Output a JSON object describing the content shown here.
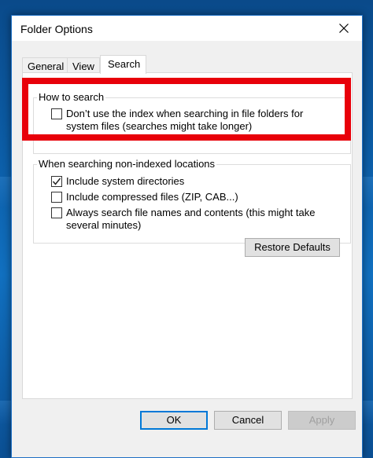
{
  "dialog": {
    "title": "Folder Options"
  },
  "tabs": [
    {
      "label": "General",
      "active": false
    },
    {
      "label": "View",
      "active": false
    },
    {
      "label": "Search",
      "active": true
    }
  ],
  "how_to_search": {
    "label": "How to search",
    "options": [
      {
        "line1": "Don’t use the index when searching in file folders for",
        "line2": "system files (searches might take longer)",
        "checked": false
      }
    ]
  },
  "non_indexed": {
    "label": "When searching non-indexed locations",
    "options": [
      {
        "line1": "Include system directories",
        "line2": "",
        "checked": true
      },
      {
        "line1": "Include compressed files (ZIP, CAB...)",
        "line2": "",
        "checked": false
      },
      {
        "line1": "Always search file names and contents (this might take",
        "line2": "several minutes)",
        "checked": false
      }
    ]
  },
  "buttons": {
    "restore_defaults": "Restore Defaults",
    "ok": "OK",
    "cancel": "Cancel",
    "apply": "Apply"
  },
  "colors": {
    "highlight": "#e8000a",
    "accent": "#0078d7"
  },
  "icons": {
    "close": "close-icon",
    "check": "checkmark-icon"
  }
}
